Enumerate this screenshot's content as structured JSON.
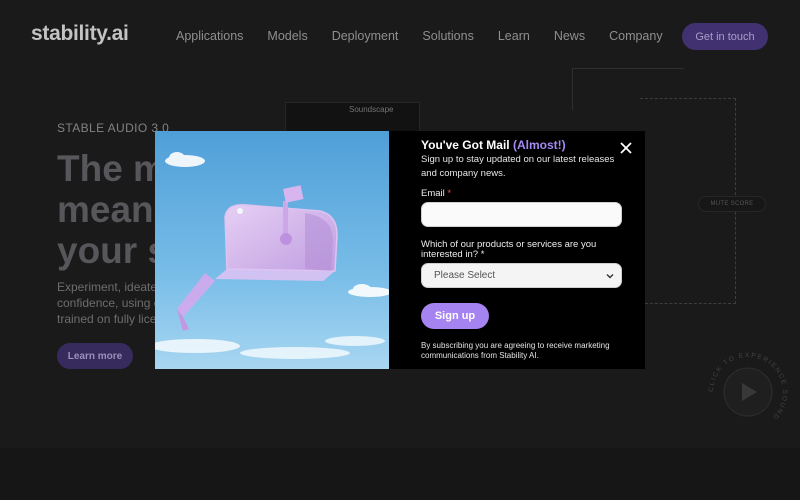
{
  "header": {
    "logo": "stability.ai",
    "nav": [
      "Applications",
      "Models",
      "Deployment",
      "Solutions",
      "Learn",
      "News",
      "Company"
    ],
    "cta": "Get in touch"
  },
  "hero": {
    "eyebrow": "STABLE AUDIO 3.0",
    "headline_lines": [
      "The m",
      "mean",
      "your s"
    ],
    "sub_lines": [
      "Experiment, ideate",
      "confidence, using c",
      "trained on fully lice"
    ],
    "learn_more": "Learn more"
  },
  "side": {
    "soundscape": "Soundscape",
    "mute": "MUTE SCORE",
    "play_ring_text": "CLICK TO EXPERIENCE SOUND"
  },
  "modal": {
    "title": "You've Got Mail",
    "title_accent": "(Almost!)",
    "description": "Sign up to stay updated on our latest releases and company news.",
    "email_label": "Email",
    "email_value": "",
    "products_label": "Which of our products or services are you interested in?",
    "select_value": "Please Select",
    "signup": "Sign up",
    "disclaimer": "By subscribing you are agreeing to receive marketing communications from Stability AI.",
    "required_mark": "*"
  },
  "colors": {
    "accent": "#a583f0",
    "cta_dark": "#47367a",
    "modal_bg": "#000000",
    "sky": "#5da9de"
  },
  "icons": {
    "close": "close-icon",
    "chevron": "chevron-down-icon",
    "play": "play-icon",
    "mailbox": "mailbox-illustration"
  }
}
